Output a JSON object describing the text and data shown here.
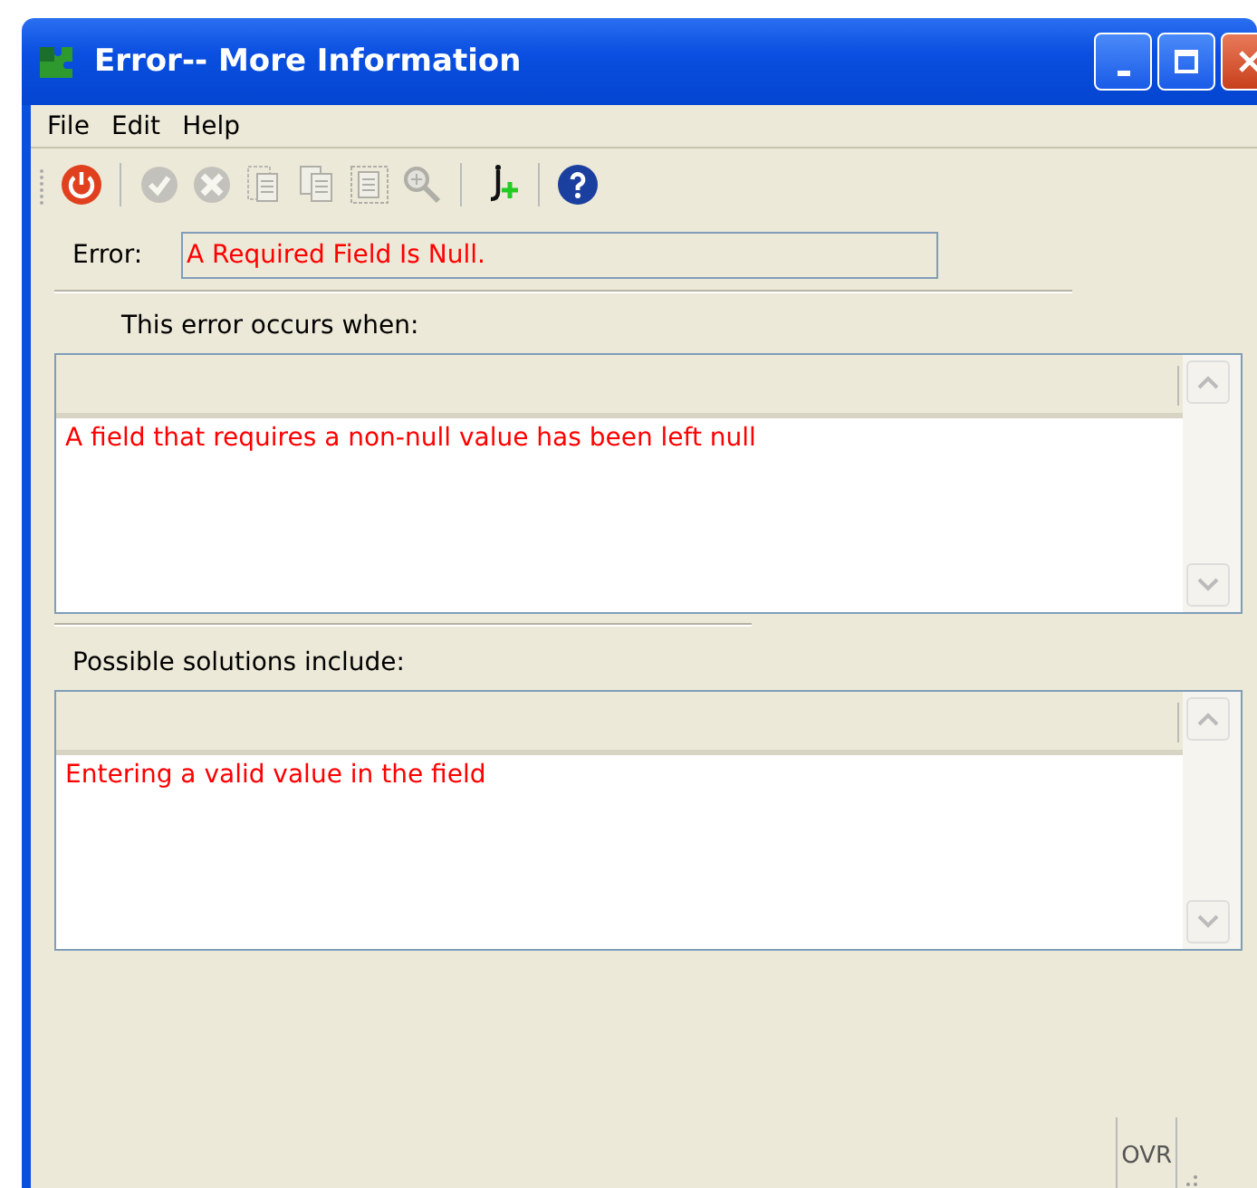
{
  "window": {
    "title": "Error-- More Information"
  },
  "menu": [
    "File",
    "Edit",
    "Help"
  ],
  "toolbar": [
    {
      "kind": "power",
      "disabled": false
    },
    {
      "kind": "sep"
    },
    {
      "kind": "check",
      "disabled": true
    },
    {
      "kind": "cancel",
      "disabled": true
    },
    {
      "kind": "doc",
      "disabled": true
    },
    {
      "kind": "docs",
      "disabled": true
    },
    {
      "kind": "docframe",
      "disabled": true
    },
    {
      "kind": "zoom",
      "disabled": true
    },
    {
      "kind": "sep"
    },
    {
      "kind": "addfunc",
      "disabled": false
    },
    {
      "kind": "sep"
    },
    {
      "kind": "help",
      "disabled": false
    }
  ],
  "error": {
    "label": "Error:",
    "value": "A Required Field Is Null."
  },
  "occurs": {
    "heading": "This error occurs when:",
    "text": "A field that requires a non-null value has been left null"
  },
  "solutions": {
    "heading": "Possible solutions include:",
    "text": "Entering a valid value in the field"
  },
  "status_bar": {
    "mode": "OVR"
  }
}
